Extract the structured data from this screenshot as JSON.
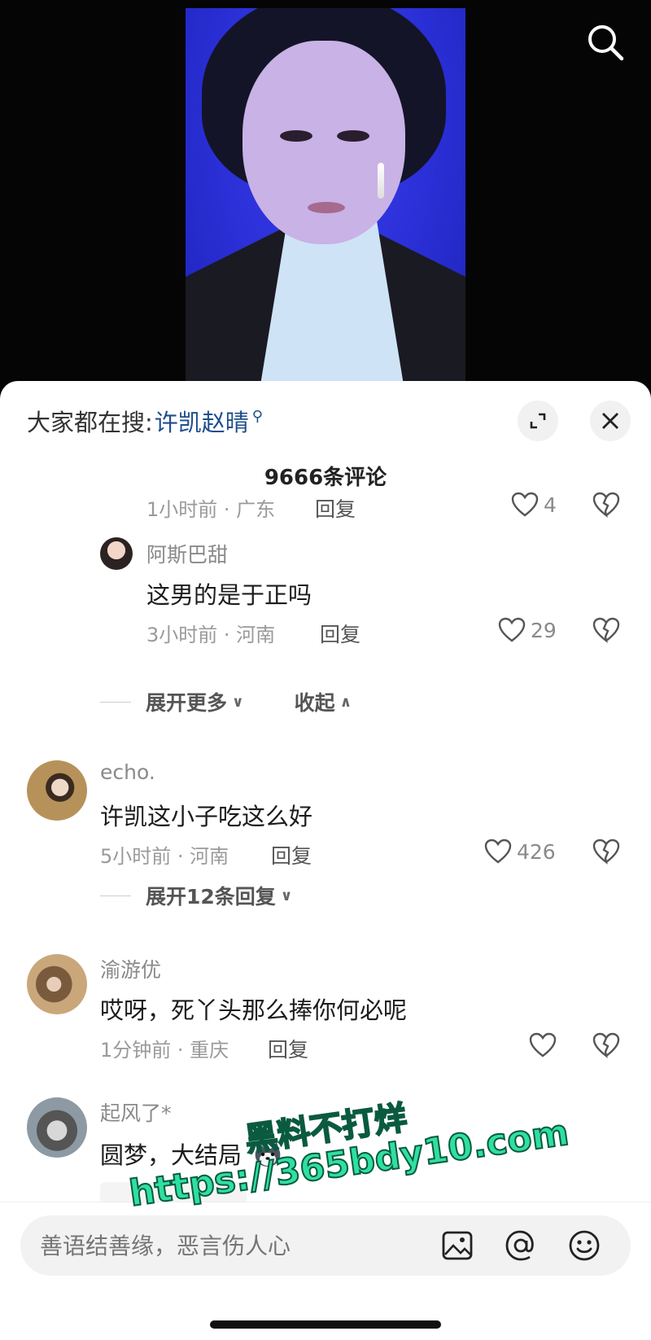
{
  "video": {
    "search_icon": "search-icon"
  },
  "sheet": {
    "hot_search_prefix": "大家都在搜:",
    "hot_search_term": "许凯赵晴",
    "comment_count": "9666条评论"
  },
  "comments": [
    {
      "meta": "1小时前 · 广东",
      "reply": "回复",
      "likes": "4"
    },
    {
      "user": "阿斯巴甜",
      "text": "这男的是于正吗",
      "meta": "3小时前 · 河南",
      "reply": "回复",
      "likes": "29"
    },
    {
      "user": "echo.",
      "text": "许凯这小子吃这么好",
      "meta": "5小时前 · 河南",
      "reply": "回复",
      "likes": "426"
    },
    {
      "user": "渝游优",
      "text": "哎呀，死丫头那么捧你何必呢",
      "meta": "1分钟前 · 重庆",
      "reply": "回复",
      "likes": ""
    },
    {
      "user": "起风了*",
      "text": "圆梦，大结局"
    }
  ],
  "expand": {
    "more": "展开更多",
    "collapse": "收起",
    "replies": "展开12条回复"
  },
  "input": {
    "placeholder": "善语结善缘，恶言伤人心",
    "icons": [
      "image-icon",
      "at-icon",
      "emoji-icon"
    ]
  },
  "watermark": {
    "line1": "黑料不打烊",
    "line2": "https://365bdy10.com"
  },
  "colors": {
    "hot_term": "#1f4e8c",
    "watermark": "#2fe0a0"
  }
}
